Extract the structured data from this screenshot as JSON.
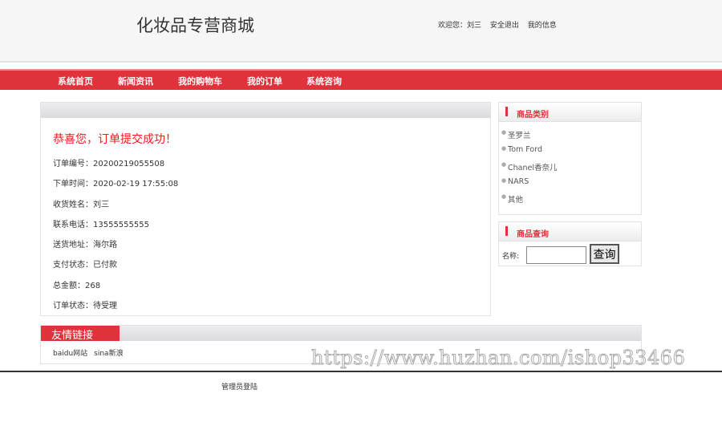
{
  "header": {
    "title": "化妆品专营商城",
    "welcome": "欢迎您：",
    "username": "刘三",
    "logout": "安全退出",
    "my_info": "我的信息"
  },
  "nav": [
    "系统首页",
    "新闻资讯",
    "我的购物车",
    "我的订单",
    "系统咨询"
  ],
  "order": {
    "success": "恭喜您，订单提交成功！",
    "fields": [
      {
        "label": "订单编号：",
        "value": "20200219055508"
      },
      {
        "label": "下单时间：",
        "value": "2020-02-19 17:55:08"
      },
      {
        "label": "收货姓名：",
        "value": "刘三"
      },
      {
        "label": "联系电话：",
        "value": "13555555555"
      },
      {
        "label": "送货地址：",
        "value": "海尔路"
      },
      {
        "label": "支付状态：",
        "value": "已付款"
      },
      {
        "label": "总金额：",
        "value": "268"
      },
      {
        "label": "订单状态：",
        "value": "待受理"
      }
    ]
  },
  "categories": {
    "title": "商品类别",
    "items": [
      "圣罗兰",
      "Tom Ford",
      "Chanel香奈儿",
      "NARS",
      "其他"
    ]
  },
  "search": {
    "title": "商品查询",
    "label": "名称:",
    "value": "",
    "button": "查询"
  },
  "friends": {
    "title": "友情链接",
    "links": [
      "baidu网站",
      "sina新浪"
    ]
  },
  "footer": {
    "admin": "管理员登陆"
  },
  "watermark": "https://www.huzhan.com/ishop33466"
}
